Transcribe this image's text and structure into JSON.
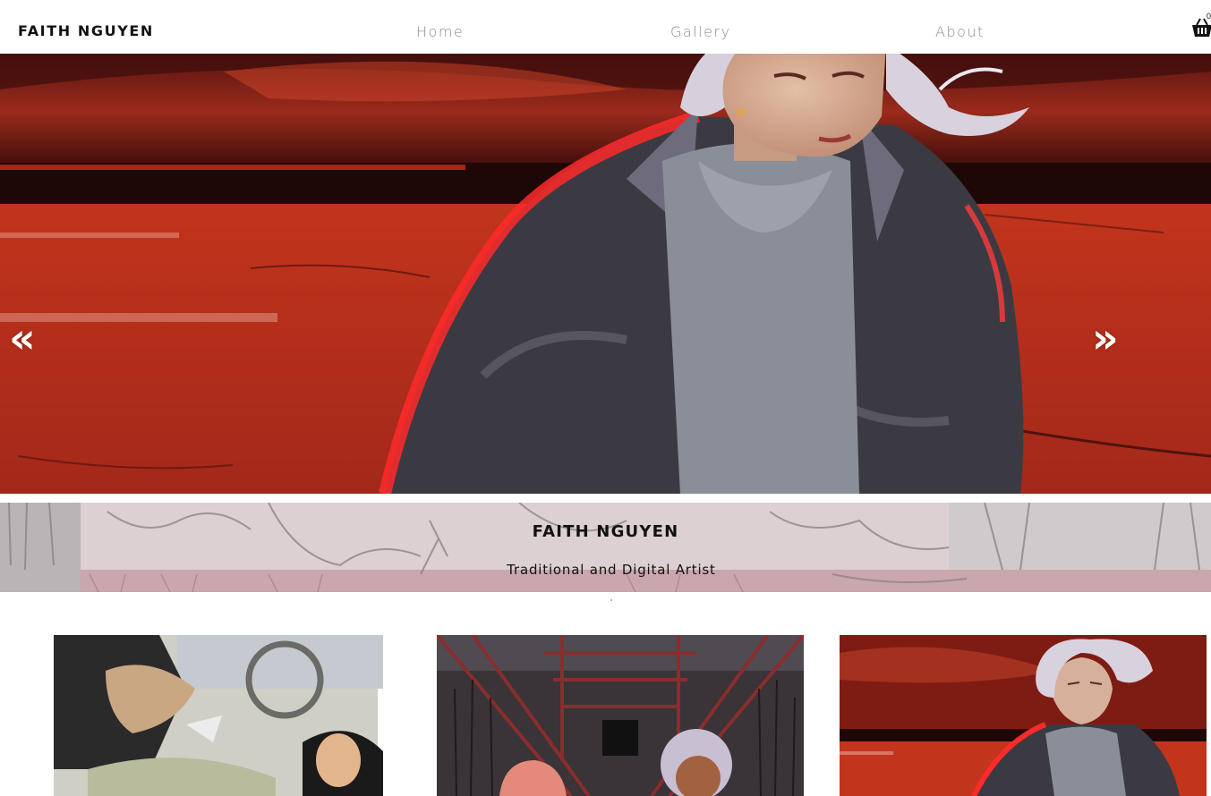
{
  "site": {
    "brand": "FAITH NGUYEN",
    "nav": [
      {
        "label": "Home"
      },
      {
        "label": "Gallery"
      },
      {
        "label": "About"
      }
    ],
    "cart": {
      "count": "0",
      "icon": "basket-icon"
    }
  },
  "hero": {
    "prev_arrow": "«",
    "next_arrow": "»",
    "prev_icon": "chevron-double-left-icon",
    "next_icon": "chevron-double-right-icon"
  },
  "banner": {
    "title": "FAITH NGUYEN",
    "subtitle": "Traditional and Digital Artist"
  },
  "gallery": {
    "items": [
      {
        "icon": "artwork-car-scene-image"
      },
      {
        "icon": "artwork-bridge-scene-image"
      },
      {
        "icon": "artwork-red-field-portrait-image"
      }
    ]
  },
  "colors": {
    "accent_red": "#b8321f",
    "nav_text": "#8a8a8a",
    "brand_text": "#111111"
  }
}
